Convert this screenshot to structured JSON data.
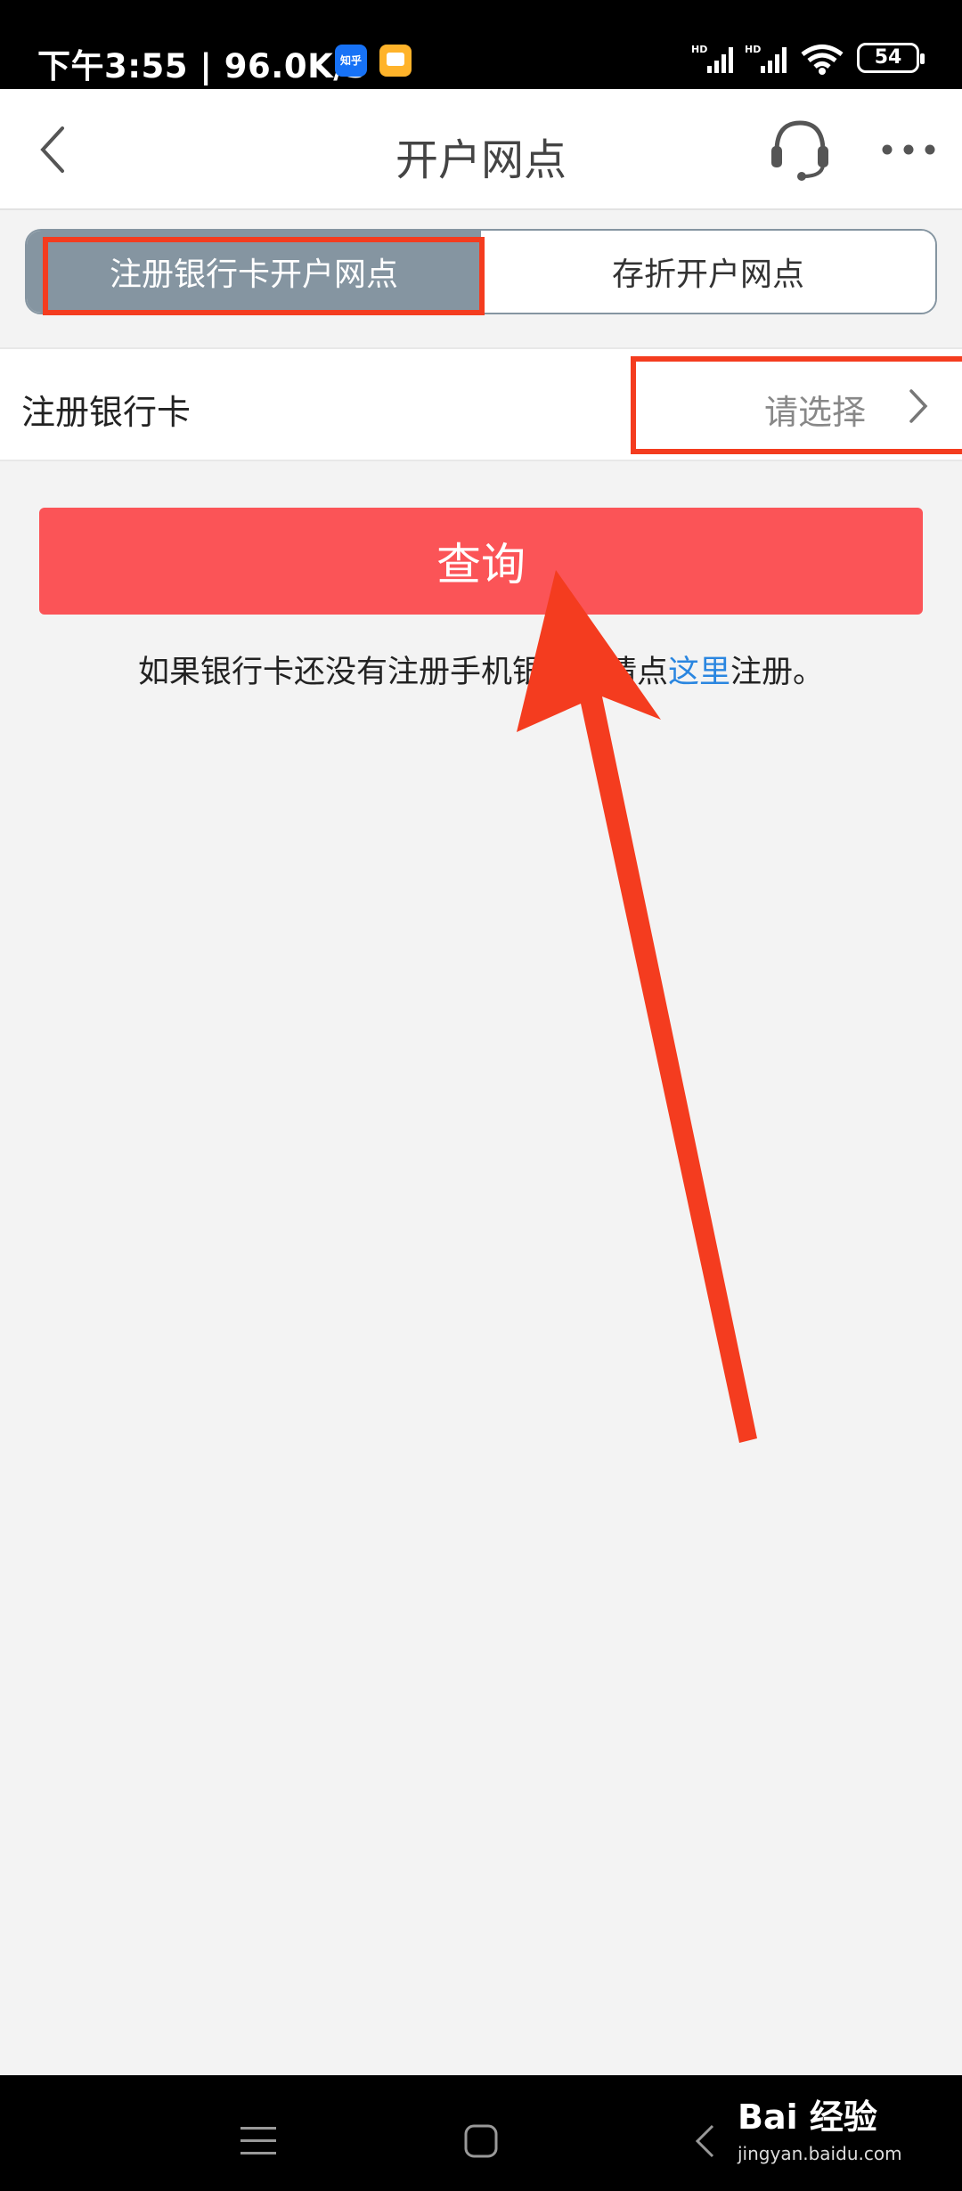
{
  "status_bar": {
    "time_speed": "下午3:55 | 96.0K/s",
    "zhihu_app": "知乎",
    "battery": "54"
  },
  "header": {
    "title": "开户网点",
    "icons": [
      "back-icon",
      "headset-icon",
      "more-icon"
    ]
  },
  "segment": {
    "tabs": [
      "注册银行卡开户网点",
      "存折开户网点"
    ],
    "active_index": 0
  },
  "form": {
    "label": "注册银行卡",
    "select_value": "请选择"
  },
  "query_button": "查询",
  "hint": {
    "before": "如果银行卡还没有注册手机银行，请点",
    "link": "这里",
    "after": "注册。"
  },
  "watermark": {
    "logo": "Bai 经验",
    "url": "jingyan.baidu.com"
  },
  "colors": {
    "segment_active": "#8595a1",
    "query_button": "#fb5457",
    "link": "#2a86e0",
    "annotation": "#f43c1f"
  }
}
